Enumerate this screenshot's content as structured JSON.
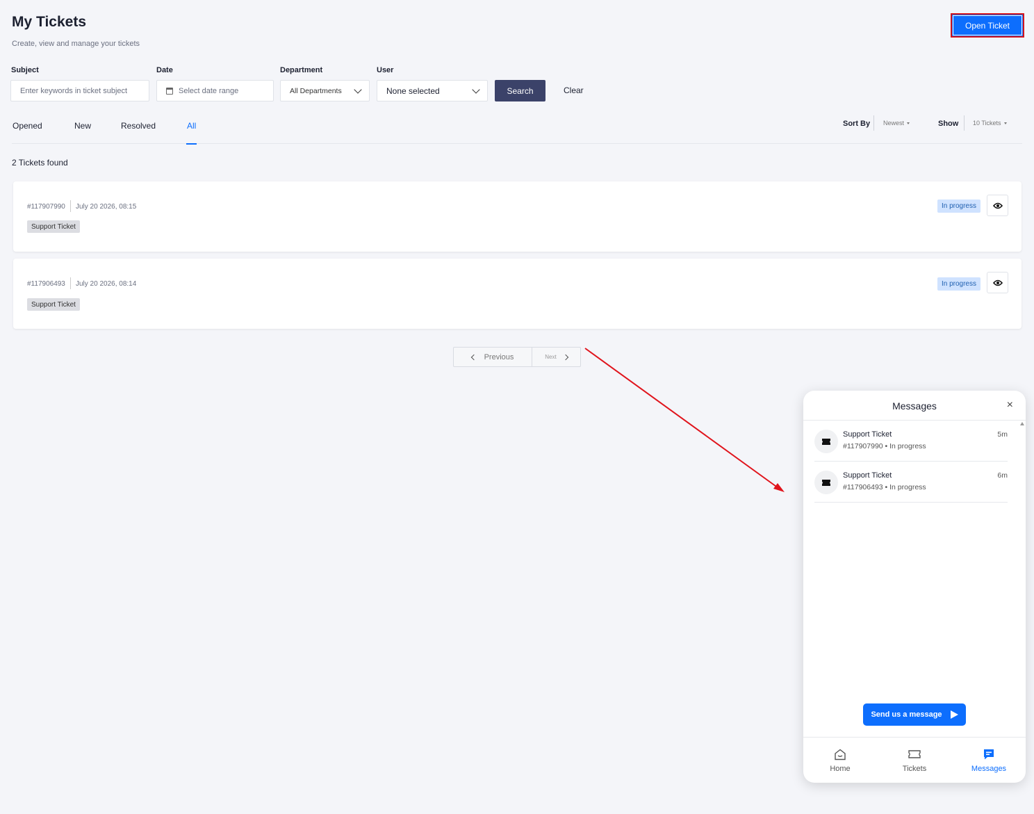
{
  "header": {
    "title": "My Tickets",
    "subtitle": "Create, view and manage your tickets",
    "open_ticket_label": "Open Ticket"
  },
  "filters": {
    "subject_label": "Subject",
    "subject_placeholder": "Enter keywords in ticket subject",
    "date_label": "Date",
    "date_placeholder": "Select date range",
    "department_label": "Department",
    "department_value": "All Departments",
    "user_label": "User",
    "user_value": "None selected",
    "search_label": "Search",
    "clear_label": "Clear"
  },
  "tabs": [
    {
      "label": "Opened",
      "active": false
    },
    {
      "label": "New",
      "active": false
    },
    {
      "label": "Resolved",
      "active": false
    },
    {
      "label": "All",
      "active": true
    }
  ],
  "sort": {
    "sort_by_label": "Sort By",
    "sort_by_value": "Newest",
    "show_label": "Show",
    "show_value": "10 Tickets"
  },
  "results_text": "2 Tickets found",
  "tickets": [
    {
      "id": "#117907990",
      "date": "July 20 2026, 08:15",
      "tag": "Support Ticket",
      "status": "In progress"
    },
    {
      "id": "#117906493",
      "date": "July 20 2026, 08:14",
      "tag": "Support Ticket",
      "status": "In progress"
    }
  ],
  "pagination": {
    "previous": "Previous",
    "next": "Next"
  },
  "widget": {
    "title": "Messages",
    "close_icon": "×",
    "messages": [
      {
        "title": "Support Ticket",
        "sub": "#117907990 • In progress",
        "time": "5m"
      },
      {
        "title": "Support Ticket",
        "sub": "#117906493 • In progress",
        "time": "6m"
      }
    ],
    "send_label": "Send us a message",
    "nav": [
      {
        "label": "Home",
        "icon": "home-icon"
      },
      {
        "label": "Tickets",
        "icon": "ticket-icon"
      },
      {
        "label": "Messages",
        "icon": "messages-icon",
        "active": true
      }
    ]
  },
  "colors": {
    "accent": "#0d6efd",
    "search_button": "#3b4269",
    "annotation": "#e0141c",
    "status_bg": "#cfe2ff"
  }
}
